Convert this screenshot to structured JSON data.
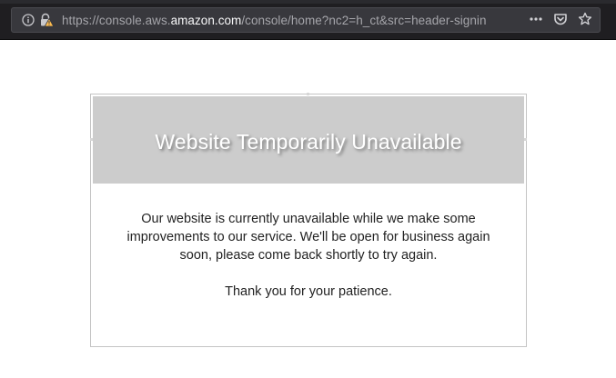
{
  "browser": {
    "url_prefix": "https://console.aws.",
    "url_domain": "amazon.com",
    "url_suffix": "/console/home?nc2=h_ct&src=header-signin",
    "icons": {
      "info": "info-icon",
      "lock": "insecure-lock-icon",
      "more": "more-actions-icon",
      "pocket": "pocket-icon",
      "bookmark": "bookmark-star-icon"
    }
  },
  "page": {
    "title": "Website Temporarily Unavailable",
    "message_lines": [
      "Our website is currently unavailable while we make some",
      "improvements to our service. We'll be open for business again",
      "soon, please come back shortly to try again."
    ],
    "thanks": "Thank you for your patience."
  },
  "colors": {
    "chrome_bg": "#1f1e21",
    "url_bar_bg": "#38383d",
    "banner_bg": "#cccccc",
    "title_text": "#ffffff",
    "body_text": "#222222",
    "card_border": "#c4c4c4",
    "warning_accent": "#ffbd4f"
  }
}
